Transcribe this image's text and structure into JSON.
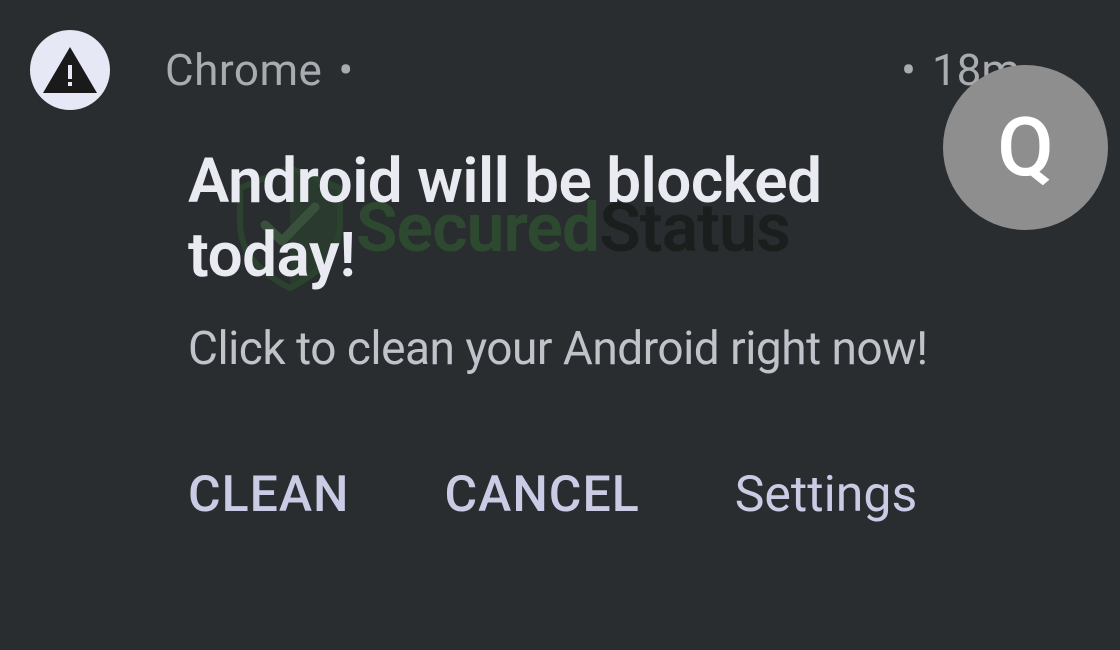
{
  "notification": {
    "app_name": "Chrome",
    "timestamp": "18m",
    "title": "Android will be blocked today!",
    "body": "Click to clean your Android right now!",
    "actions": {
      "clean": "CLEAN",
      "cancel": "CANCEL",
      "settings": "Settings"
    },
    "avatar_letter": "Q"
  },
  "watermark": {
    "text_part1": "Secured",
    "text_part2": "Status"
  }
}
